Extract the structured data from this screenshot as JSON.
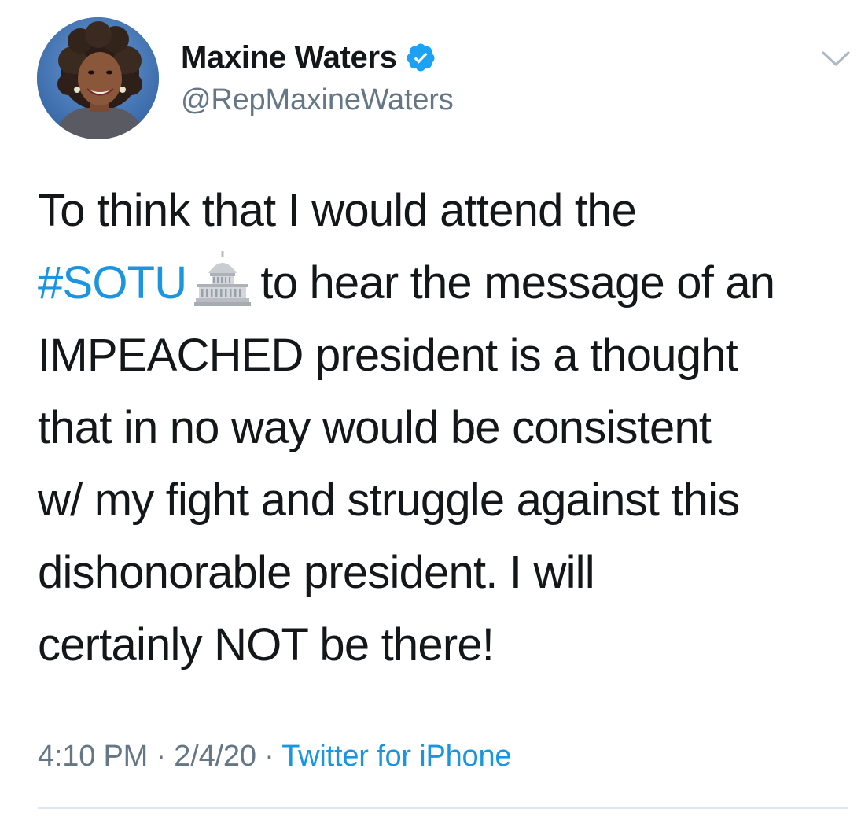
{
  "author": {
    "display_name": "Maxine Waters",
    "handle": "@RepMaxineWaters",
    "verified_icon": "verified-badge-icon",
    "avatar_icon": "profile-photo"
  },
  "menu": {
    "caret_icon": "chevron-down-icon"
  },
  "tweet": {
    "line1": "To think that I would attend the",
    "hashtag": "#SOTU",
    "emoji_icon": "capitol-building-icon",
    "line2_rest": "to hear the message of an",
    "line3": "IMPEACHED president is a thought",
    "line4": "that in no way would be consistent",
    "line5": "w/ my fight and struggle against this",
    "line6": "dishonorable president. I will",
    "line7": "certainly NOT be there!"
  },
  "meta": {
    "time": "4:10 PM",
    "separator1": " · ",
    "date": "2/4/20",
    "separator2": " · ",
    "source": "Twitter for iPhone"
  },
  "colors": {
    "link": "#1b95e0",
    "secondary_text": "#657786",
    "primary_text": "#14171a",
    "divider": "#e1e8ed"
  }
}
